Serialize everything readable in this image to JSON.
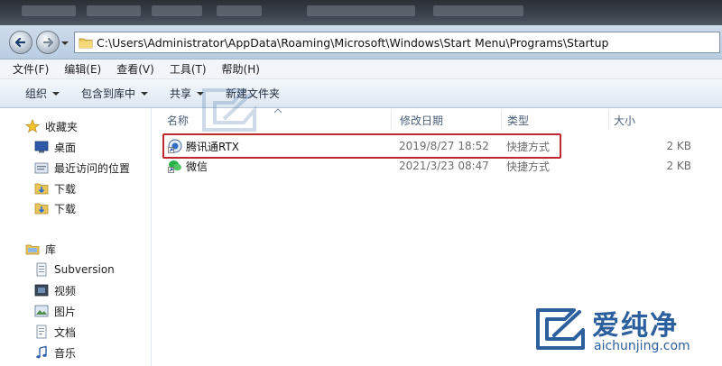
{
  "window": {
    "address_path": "C:\\Users\\Administrator\\AppData\\Roaming\\Microsoft\\Windows\\Start Menu\\Programs\\Startup"
  },
  "menu": {
    "items": [
      "文件(F)",
      "编辑(E)",
      "查看(V)",
      "工具(T)",
      "帮助(H)"
    ]
  },
  "toolbar": {
    "organize": "组织",
    "include_in_library": "包含到库中",
    "share": "共享",
    "new_folder": "新建文件夹"
  },
  "navpane": {
    "favorites": "收藏夹",
    "desktop": "桌面",
    "recent": "最近访问的位置",
    "downloads1": "下载",
    "downloads2": "下载",
    "libraries": "库",
    "subversion": "Subversion",
    "videos": "视频",
    "pictures": "图片",
    "documents": "文档",
    "music": "音乐"
  },
  "columns": {
    "name": "名称",
    "date": "修改日期",
    "type": "类型",
    "size": "大小"
  },
  "files": [
    {
      "name": "腾讯通RTX",
      "date": "2019/8/27 18:52",
      "type": "快捷方式",
      "size": "2 KB"
    },
    {
      "name": "微信",
      "date": "2021/3/23 08:47",
      "type": "快捷方式",
      "size": "2 KB"
    }
  ],
  "watermark": {
    "brand": "爱纯净",
    "domain": "aichunjing.com"
  },
  "colors": {
    "highlight_border": "#c0282d",
    "brand_blue": "#2c5f9e"
  }
}
